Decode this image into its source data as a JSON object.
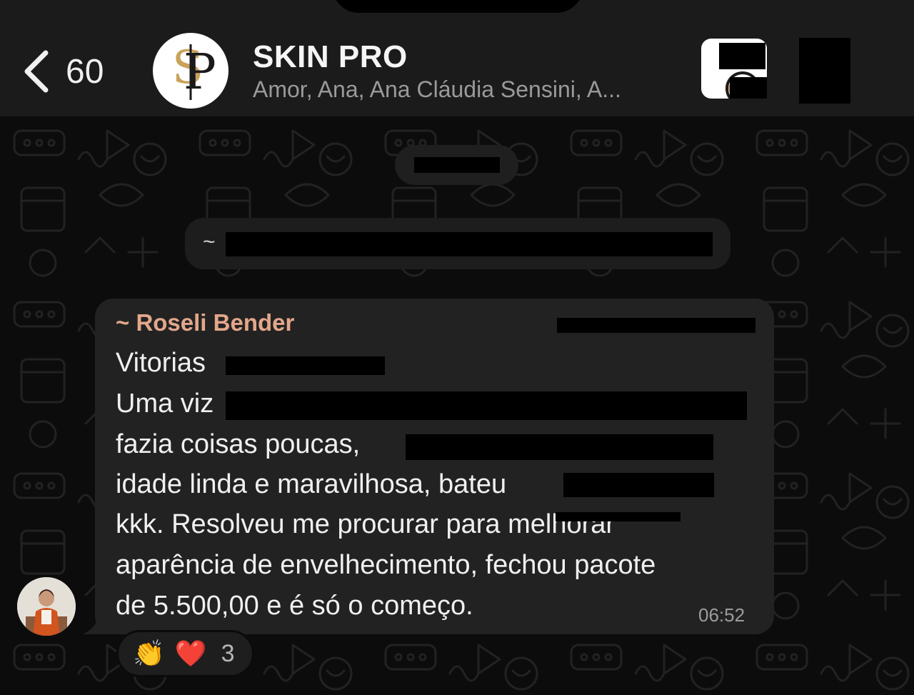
{
  "header": {
    "back_count": "60",
    "title": "SKIN PRO",
    "members": "Amor, Ana, Ana Cláudia Sensini, A...",
    "avatar_logo": "SP"
  },
  "chat": {
    "system_prefix": "~",
    "message": {
      "sender": "~ Roseli Bender",
      "lines": [
        "Vitorias",
        "Uma viz",
        "fazia coisas poucas,",
        "idade linda e maravilhosa, bateu",
        "kkk. Resolveu me procurar para melhorar",
        "aparência de envelhecimento,  fechou pacote",
        "de 5.500,00 e é só o começo."
      ],
      "time": "06:52"
    },
    "reactions": {
      "emoji_1": "👏",
      "emoji_2": "❤️",
      "count": "3"
    }
  },
  "colors": {
    "header_bg": "#1b1b1b",
    "bubble_bg": "#222222",
    "sender_name": "#e3a78a",
    "muted_text": "#9a9a9a"
  },
  "icons": [
    "back-chevron-icon",
    "video-call-icon",
    "phone-icon"
  ]
}
